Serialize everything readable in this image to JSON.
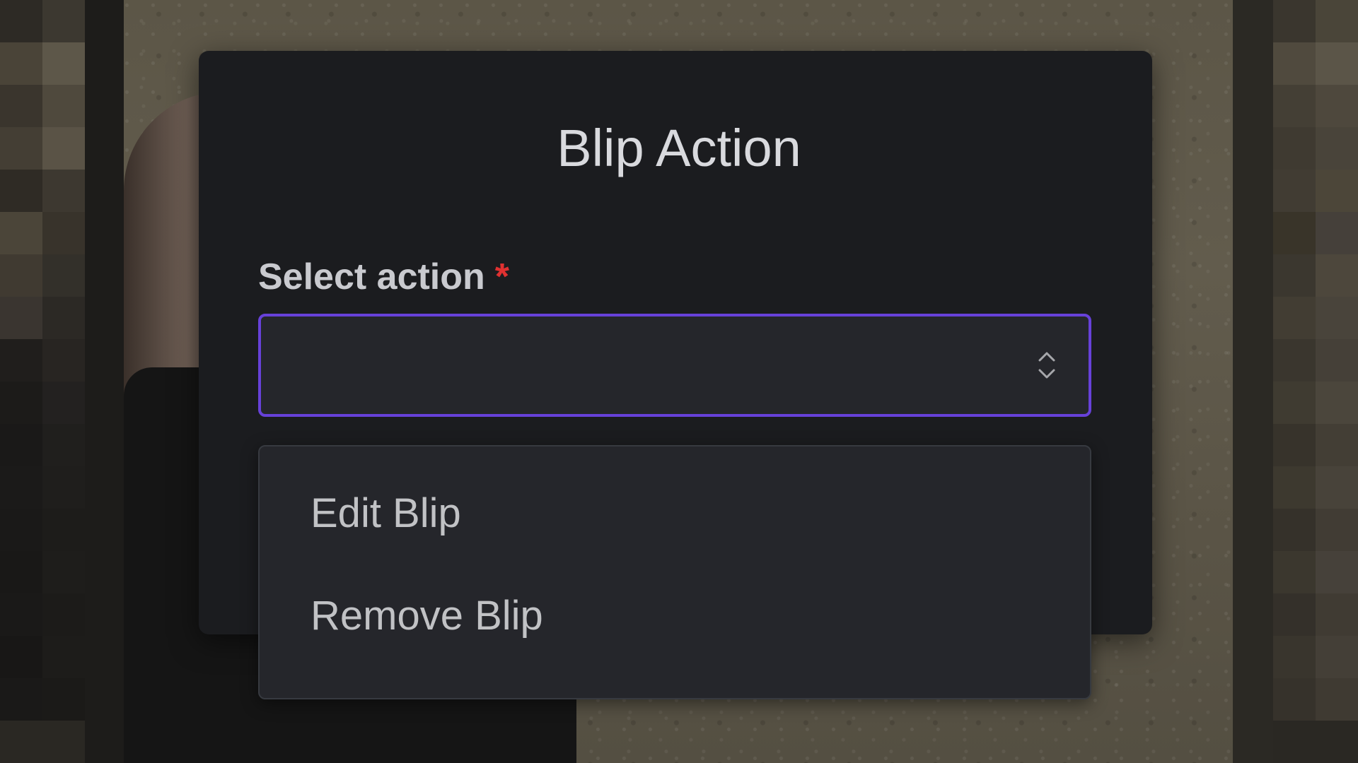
{
  "modal": {
    "title": "Blip Action",
    "field": {
      "label": "Select action",
      "required_mark": "*",
      "selected_value": ""
    },
    "dropdown": {
      "options": [
        {
          "label": "Edit Blip"
        },
        {
          "label": "Remove Blip"
        }
      ]
    }
  },
  "icons": {
    "select_indicator": "chevron-up-down-icon"
  },
  "colors": {
    "modal_bg": "#1b1c1f",
    "input_bg": "#25262b",
    "focus_border": "#6741d9",
    "required": "#e03131",
    "text_primary": "#d9dade",
    "text_option": "#c1c2c5"
  }
}
